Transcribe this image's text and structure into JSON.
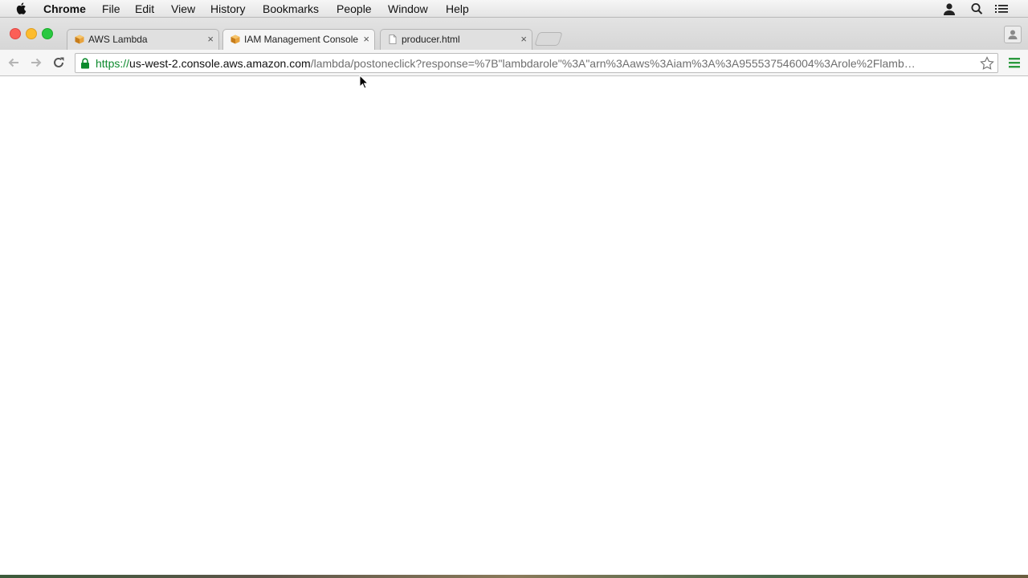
{
  "menubar": {
    "app_name": "Chrome",
    "items": [
      "File",
      "Edit",
      "View",
      "History",
      "Bookmarks",
      "People",
      "Window",
      "Help"
    ],
    "icons": [
      "apple-icon",
      "user-icon",
      "search-icon",
      "list-icon"
    ]
  },
  "tabs": [
    {
      "title": "AWS Lambda",
      "favicon": "aws-cube-icon",
      "active": false
    },
    {
      "title": "IAM Management Console",
      "favicon": "aws-cube-icon",
      "active": true
    },
    {
      "title": "producer.html",
      "favicon": "document-icon",
      "active": false
    }
  ],
  "toolbar": {
    "url": {
      "scheme": "https://",
      "host": "us-west-2.console.aws.amazon.com",
      "path": "/lambda/postoneclick?response=%7B\"lambdarole\"%3A\"arn%3Aaws%3Aiam%3A%3A955537546004%3Arole%2Flamb…"
    }
  },
  "colors": {
    "url_scheme": "#0c8a2d",
    "close": "#fc5f57",
    "minimize": "#fdbc2e",
    "maximize": "#29c841",
    "aws_orange": "#e8a33d"
  }
}
